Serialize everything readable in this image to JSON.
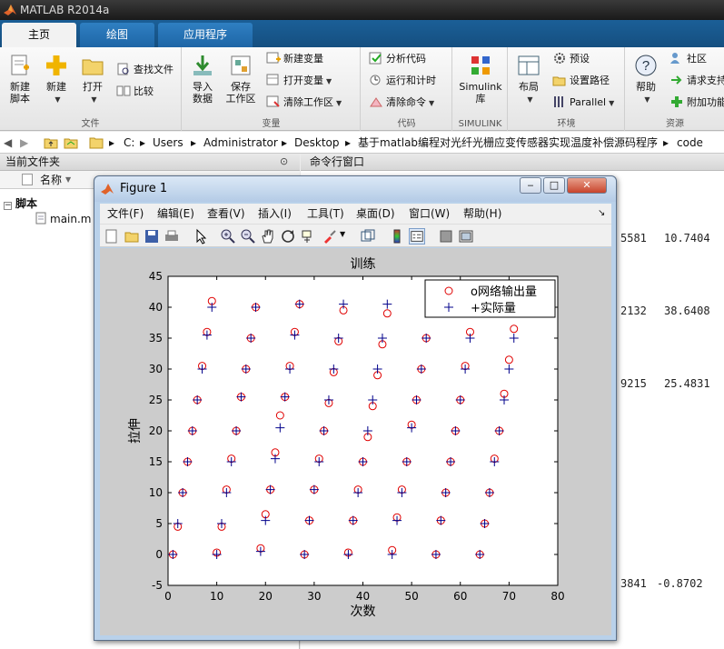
{
  "app": {
    "title": "MATLAB R2014a"
  },
  "tabs": [
    {
      "label": "主页",
      "active": true
    },
    {
      "label": "绘图",
      "active": false
    },
    {
      "label": "应用程序",
      "active": false
    }
  ],
  "ribbon": {
    "file": {
      "new_script": "新建\n脚本",
      "new": "新建",
      "open": "打开",
      "find_files": "查找文件",
      "compare": "比较",
      "section": "文件"
    },
    "variable": {
      "import": "导入\n数据",
      "save_ws": "保存\n工作区",
      "new_var": "新建变量",
      "open_var": "打开变量",
      "clear_ws": "清除工作区",
      "section": "变量"
    },
    "code": {
      "analyze": "分析代码",
      "run_time": "运行和计时",
      "clear_cmd": "清除命令",
      "section": "代码"
    },
    "simulink": {
      "label": "Simulink\n库",
      "section": "SIMULINK"
    },
    "env": {
      "layout": "布局",
      "prefs": "预设",
      "set_path": "设置路径",
      "parallel": "Parallel",
      "section": "环境"
    },
    "resources": {
      "help": "帮助",
      "community": "社区",
      "request": "请求支持",
      "addons": "附加功能",
      "section": "资源"
    }
  },
  "address": {
    "drive": "C:",
    "parts": [
      "Users",
      "Administrator",
      "Desktop",
      "基于matlab编程对光纤光栅应变传感器实现温度补偿源码程序",
      "code"
    ]
  },
  "left_panel": {
    "title": "当前文件夹",
    "col_name": "名称",
    "group": "脚本",
    "file": "main.m"
  },
  "command": {
    "title": "命令行窗口",
    "rows": [
      {
        "a": "5581",
        "b": "10.7404"
      },
      {
        "a": "2132",
        "b": "38.6408"
      },
      {
        "a": "9215",
        "b": "25.4831"
      },
      {
        "a": "3841",
        "b": "-0.8702"
      }
    ]
  },
  "figure": {
    "title": "Figure 1",
    "menus": [
      "文件(F)",
      "编辑(E)",
      "查看(V)",
      "插入(I)",
      "工具(T)",
      "桌面(D)",
      "窗口(W)",
      "帮助(H)"
    ],
    "colors": {
      "circle": "#e00000",
      "plus": "#00008b"
    }
  },
  "chart_data": {
    "type": "scatter",
    "title": "训练",
    "xlabel": "次数",
    "ylabel": "拉伸",
    "xlim": [
      0,
      80
    ],
    "ylim": [
      -5,
      45
    ],
    "xticks": [
      0,
      10,
      20,
      30,
      40,
      50,
      60,
      70,
      80
    ],
    "yticks": [
      -5,
      0,
      5,
      10,
      15,
      20,
      25,
      30,
      35,
      40,
      45
    ],
    "legend_position": "top-right",
    "series": [
      {
        "name": "o网络输出量",
        "marker": "o",
        "points": [
          [
            1,
            0
          ],
          [
            10,
            0.3
          ],
          [
            19,
            1
          ],
          [
            28,
            0
          ],
          [
            37,
            0.3
          ],
          [
            46,
            0.7
          ],
          [
            55,
            0
          ],
          [
            64,
            0
          ],
          [
            2,
            4.5
          ],
          [
            11,
            4.5
          ],
          [
            20,
            6.5
          ],
          [
            29,
            5.5
          ],
          [
            38,
            5.5
          ],
          [
            47,
            6
          ],
          [
            56,
            5.5
          ],
          [
            65,
            5
          ],
          [
            3,
            10
          ],
          [
            12,
            10.5
          ],
          [
            21,
            10.5
          ],
          [
            30,
            10.5
          ],
          [
            39,
            10.5
          ],
          [
            48,
            10.5
          ],
          [
            57,
            10
          ],
          [
            66,
            10
          ],
          [
            4,
            15
          ],
          [
            13,
            15.5
          ],
          [
            22,
            16.5
          ],
          [
            31,
            15.5
          ],
          [
            40,
            15
          ],
          [
            49,
            15
          ],
          [
            58,
            15
          ],
          [
            67,
            15.5
          ],
          [
            5,
            20
          ],
          [
            14,
            20
          ],
          [
            23,
            22.5
          ],
          [
            32,
            20
          ],
          [
            41,
            19
          ],
          [
            50,
            21
          ],
          [
            59,
            20
          ],
          [
            68,
            20
          ],
          [
            6,
            25
          ],
          [
            15,
            25.5
          ],
          [
            24,
            25.5
          ],
          [
            33,
            24.5
          ],
          [
            42,
            24
          ],
          [
            51,
            25
          ],
          [
            60,
            25
          ],
          [
            69,
            26
          ],
          [
            7,
            30.5
          ],
          [
            16,
            30
          ],
          [
            25,
            30.5
          ],
          [
            34,
            29.5
          ],
          [
            43,
            29
          ],
          [
            52,
            30
          ],
          [
            61,
            30.5
          ],
          [
            70,
            31.5
          ],
          [
            8,
            36
          ],
          [
            17,
            35
          ],
          [
            26,
            36
          ],
          [
            35,
            34.5
          ],
          [
            44,
            34
          ],
          [
            53,
            35
          ],
          [
            62,
            36
          ],
          [
            71,
            36.5
          ],
          [
            9,
            41
          ],
          [
            18,
            40
          ],
          [
            27,
            40.5
          ],
          [
            36,
            39.5
          ],
          [
            45,
            39
          ],
          [
            54,
            40
          ]
        ]
      },
      {
        "name": "+实际量",
        "marker": "+",
        "points": [
          [
            1,
            0
          ],
          [
            10,
            0
          ],
          [
            19,
            0.5
          ],
          [
            28,
            0
          ],
          [
            37,
            0
          ],
          [
            46,
            0
          ],
          [
            55,
            0
          ],
          [
            64,
            0
          ],
          [
            2,
            5
          ],
          [
            11,
            5
          ],
          [
            20,
            5.5
          ],
          [
            29,
            5.5
          ],
          [
            38,
            5.5
          ],
          [
            47,
            5.5
          ],
          [
            56,
            5.5
          ],
          [
            65,
            5
          ],
          [
            3,
            10
          ],
          [
            12,
            10
          ],
          [
            21,
            10.5
          ],
          [
            30,
            10.5
          ],
          [
            39,
            10
          ],
          [
            48,
            10
          ],
          [
            57,
            10
          ],
          [
            66,
            10
          ],
          [
            4,
            15
          ],
          [
            13,
            15
          ],
          [
            22,
            15.5
          ],
          [
            31,
            15
          ],
          [
            40,
            15
          ],
          [
            49,
            15
          ],
          [
            58,
            15
          ],
          [
            67,
            15
          ],
          [
            5,
            20
          ],
          [
            14,
            20
          ],
          [
            23,
            20.5
          ],
          [
            32,
            20
          ],
          [
            41,
            20
          ],
          [
            50,
            20.5
          ],
          [
            59,
            20
          ],
          [
            68,
            20
          ],
          [
            6,
            25
          ],
          [
            15,
            25.5
          ],
          [
            24,
            25.5
          ],
          [
            33,
            25
          ],
          [
            42,
            25
          ],
          [
            51,
            25
          ],
          [
            60,
            25
          ],
          [
            69,
            25
          ],
          [
            7,
            30
          ],
          [
            16,
            30
          ],
          [
            25,
            30
          ],
          [
            34,
            30
          ],
          [
            43,
            30
          ],
          [
            52,
            30
          ],
          [
            61,
            30
          ],
          [
            70,
            30
          ],
          [
            8,
            35.5
          ],
          [
            17,
            35
          ],
          [
            26,
            35.5
          ],
          [
            35,
            35
          ],
          [
            44,
            35
          ],
          [
            53,
            35
          ],
          [
            62,
            35
          ],
          [
            71,
            35
          ],
          [
            9,
            40
          ],
          [
            18,
            40
          ],
          [
            27,
            40.5
          ],
          [
            36,
            40.5
          ],
          [
            45,
            40.5
          ],
          [
            54,
            40
          ]
        ]
      }
    ]
  }
}
